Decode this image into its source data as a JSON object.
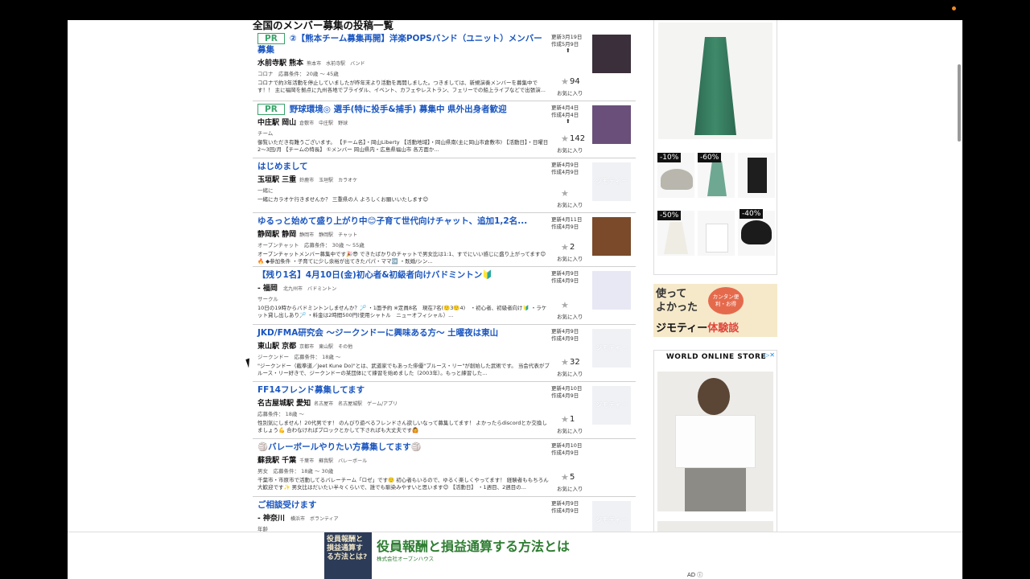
{
  "list_title": "全国のメンバー募集の投稿一覧",
  "posts": [
    {
      "pr": "PR",
      "title": "②【熊本チーム募集再開】洋楽POPSバンド（ユニット）メンバー募集",
      "station": "水前寺駅",
      "pref": "熊本",
      "sub": "熊本市　水前寺駅　バンド",
      "tags": "コロナ　応募条件： 20歳 ～ 45歳",
      "body": "コロナで約3年活動を停止していましたが昨年末より活動を再開しました。つきましては、新規演奏メンバーを募集中です！！ 主に福岡を拠点に九州各地でブライダル、イベント、カフェやレストラン、フェリーでの船上ライブなどで出張演...",
      "updated": "更新3月19日",
      "created": "作成5月9日",
      "count": "94",
      "fav": "お気に入り"
    },
    {
      "pr": "PR",
      "title": "野球環境◎ 選手(特に投手&捕手) 募集中 県外出身者歓迎",
      "station": "中庄駅",
      "pref": "岡山",
      "sub": "倉敷市　中庄駅　野球",
      "tags": "チーム",
      "body": "御覧いただき有難うございます。 【チーム名】・岡山Liberty 【活動地域】・岡山県南(主に岡山市倉敷市) 【活動日】・日曜日2～3回/月 【チームの特長】 ①メンバー 岡山県内・広島県福山市 各方面か...",
      "updated": "更新4月4日",
      "created": "作成4月4日",
      "count": "142",
      "fav": "お気に入り"
    },
    {
      "title": "はじめまして",
      "station": "玉垣駅",
      "pref": "三重",
      "sub": "鈴鹿市　玉垣駅　カラオケ",
      "tags": "一緒に",
      "body": "一緒にカラオケ行きませんか？ 三重県の人 よろしくお願いいたします😊",
      "updated": "更新4月9日",
      "created": "作成4月9日",
      "count": "",
      "fav": "お気に入り"
    },
    {
      "title": "ゆるっと始めて盛り上がり中😊子育て世代向けチャット、追加1,2名...",
      "station": "静岡駅",
      "pref": "静岡",
      "sub": "静岡市　静岡駅　チャット",
      "tags": "オープンチャット　応募条件： 30歳 ～ 55歳",
      "body": "オープンチャットメンバー募集中です🎉😎 できたばかりのチャットで男女比は1:1、すでにいい感じに盛り上がってます😊🔥 ◆参加条件 ・子育てに少し余裕が出てきたパパ・ママ🆗 ・既婚/シン...",
      "updated": "更新4月11日",
      "created": "作成4月9日",
      "count": "2",
      "fav": "お気に入り"
    },
    {
      "title": "【残り1名】4月10日(金)初心者&初級者向けバドミントン🔰",
      "station": "- 福岡",
      "pref": "",
      "sub": "北九州市　バドミントン",
      "tags": "サークル",
      "body": "10日の19時からバドミントンしませんか？🏸 ・1面予約 ※定員8名　現在7名(🙂3🙂4)　・初心者、初級者向け🔰 ・ラケット貸し出しあり🏸 ・料金は2時間500円(使用シャトル　ニューオフィシャル）...",
      "updated": "更新4月9日",
      "created": "作成4月9日",
      "count": "",
      "fav": "お気に入り"
    },
    {
      "title": "JKD/FMA研究会 〜ジークンドーに興味ある方〜 土曜夜は東山",
      "station": "東山駅",
      "pref": "京都",
      "sub": "京都市　東山駅　その他",
      "tags": "ジークンドー　応募条件： 18歳 ～",
      "body": "\"ジークンドー（截拳道／Jeet Kune Do)\"とは、武道家でもあった俳優\"ブルース・リー\"が創始した武術です。 当会代表がブルース・リー好きで、ジークンドーの某団体にて練習を始めました（2003年）。もっと練習した...",
      "updated": "更新4月9日",
      "created": "作成4月9日",
      "count": "32",
      "fav": "お気に入り"
    },
    {
      "title": "FF14フレンド募集してます",
      "station": "名古屋城駅",
      "pref": "愛知",
      "sub": "名古屋市　名古屋城駅　ゲーム/アプリ",
      "tags": "応募条件： 18歳 ～",
      "body": "性別気にしません！20代男です！ のんびり遊べるフレンドさん欲しいなって募集してます！ よかったらdiscordとか交換しましょう💪 合わなければブロックとかして下さればも大丈夫です🙆",
      "updated": "更新4月10日",
      "created": "作成4月9日",
      "count": "1",
      "fav": "お気に入り"
    },
    {
      "title": "🏐バレーボールやりたい方募集してます🏐",
      "station": "蘇我駅",
      "pref": "千葉",
      "sub": "千葉市　蘇我駅　バレーボール",
      "tags": "男女　応募条件： 18歳 ～ 30歳",
      "body": "千葉市・市原市で活動してるバレーチーム「ロゼ」です🙂 初心者もいるので、ゆるく楽しくやってます！ 経験者ももちろん大歓迎です✨ 男女比はだいたい半々くらいで、誰でも馴染みやすいと思います😊 【活動日】 ・1週目、2週目の...",
      "updated": "更新4月10日",
      "created": "作成4月9日",
      "count": "5",
      "fav": "お気に入り"
    },
    {
      "title": "ご相談受けます",
      "station": "- 神奈川",
      "pref": "",
      "sub": "横浜市　ボランティア",
      "tags": "年齢",
      "body": "",
      "updated": "更新4月9日",
      "created": "作成4月9日",
      "count": "",
      "fav": ""
    }
  ],
  "placeholder_logo": "ジモティー",
  "side": {
    "badges": [
      "-10%",
      "-60%",
      "-50%",
      "-40%"
    ],
    "banner_line1": "使って",
    "banner_line2": "よかった",
    "banner_bubble": "カンタン便利・お得",
    "banner_brand": "ジモティー",
    "banner_suffix": "体験談",
    "ad_title": "WORLD ONLINE STORE",
    "ad_close": "▷✕"
  },
  "bottom_ad": {
    "book": "役員報酬と損益通算する方法とは?",
    "headline": "役員報酬と損益通算する方法とは",
    "company": "株式会社オープンハウス",
    "label": "AD ⓘ"
  },
  "colors": {
    "link": "#1a56c0",
    "pr": "#3aa36a",
    "ad_green": "#2e7d32"
  }
}
